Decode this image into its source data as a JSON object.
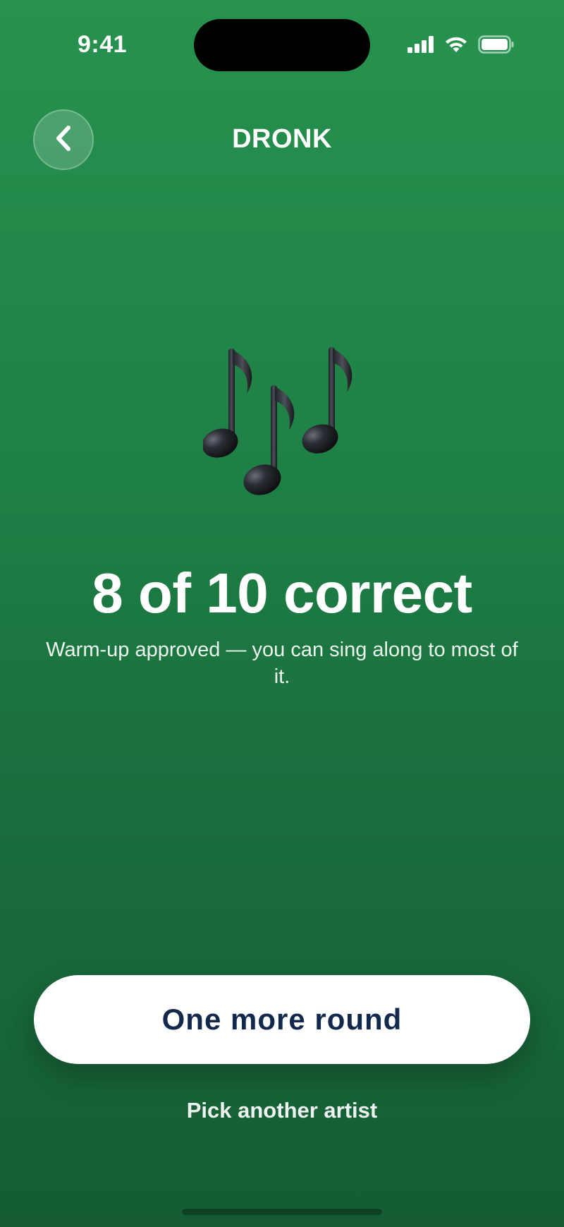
{
  "status_bar": {
    "time": "9:41",
    "icons": [
      "cellular-signal-icon",
      "wifi-icon",
      "battery-icon"
    ]
  },
  "header": {
    "back_icon": "chevron-left-icon",
    "title": "DRONK"
  },
  "art": {
    "icon": "musical-notes-icon",
    "emoji": "🎶"
  },
  "result": {
    "title": "8 of 10 correct",
    "subtitle": "Warm-up approved — you can sing along to most of it."
  },
  "actions": {
    "primary_label": "One more round",
    "secondary_label": "Pick another artist"
  },
  "colors": {
    "background_top": "#27924f",
    "background_bottom": "#155c34",
    "primary_text": "#13294b"
  }
}
